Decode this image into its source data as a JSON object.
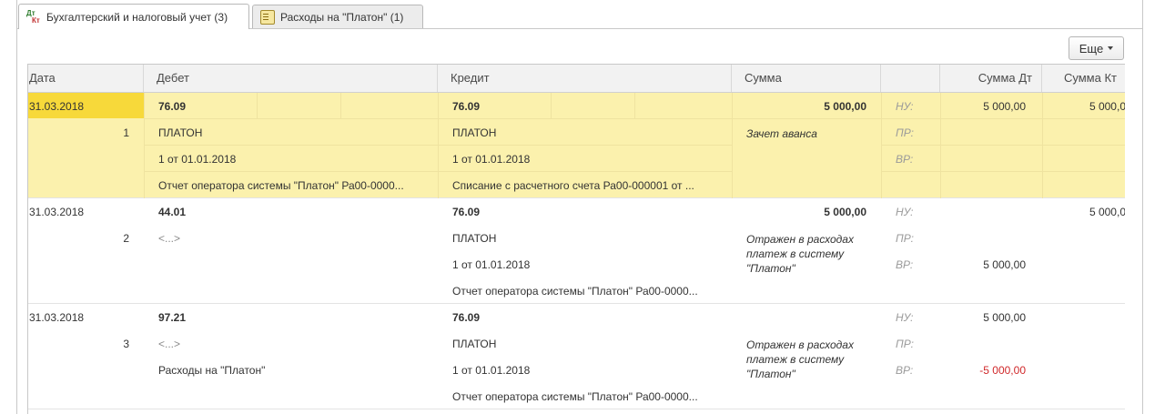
{
  "tabs": [
    {
      "label": "Бухгалтерский и налоговый учет (3)",
      "icon": "dt-kt-icon"
    },
    {
      "label": "Расходы на \"Платон\" (1)",
      "icon": "document-icon"
    }
  ],
  "more_button": {
    "label": "Еще"
  },
  "columns": [
    "Дата",
    "Дебет",
    "Кредит",
    "Сумма",
    "",
    "Сумма Дт",
    "Сумма Кт"
  ],
  "entries": [
    {
      "date": "31.03.2018",
      "num": "1",
      "debit": {
        "account": "76.09",
        "sub1": "ПЛАТОН",
        "sub2": "1 от 01.01.2018",
        "sub3": "Отчет оператора системы \"Платон\" Ра00-0000..."
      },
      "credit": {
        "account": "76.09",
        "sub1": "ПЛАТОН",
        "sub2": "1 от 01.01.2018",
        "sub3": "Списание с расчетного счета Ра00-000001 от ..."
      },
      "amount": "5 000,00",
      "content": "Зачет аванса",
      "codes": [
        "НУ:",
        "ПР:",
        "ВР:"
      ],
      "dt": {
        "nu": "5 000,00",
        "pr": "",
        "vr": ""
      },
      "kt": {
        "nu": "5 000,0",
        "pr": "",
        "vr": ""
      }
    },
    {
      "date": "31.03.2018",
      "num": "2",
      "debit": {
        "account": "44.01",
        "sub1": "<...>",
        "sub2": "",
        "sub3": ""
      },
      "credit": {
        "account": "76.09",
        "sub1": "ПЛАТОН",
        "sub2": "1 от 01.01.2018",
        "sub3": "Отчет оператора системы \"Платон\" Ра00-0000..."
      },
      "amount": "5 000,00",
      "content": "Отражен в расходах платеж в систему \"Платон\"",
      "codes": [
        "НУ:",
        "ПР:",
        "ВР:"
      ],
      "dt": {
        "nu": "",
        "pr": "",
        "vr": "5 000,00"
      },
      "kt": {
        "nu": "5 000,0",
        "pr": "",
        "vr": ""
      }
    },
    {
      "date": "31.03.2018",
      "num": "3",
      "debit": {
        "account": "97.21",
        "sub1": "<...>",
        "sub2": "Расходы на \"Платон\"",
        "sub3": ""
      },
      "credit": {
        "account": "76.09",
        "sub1": "ПЛАТОН",
        "sub2": "1 от 01.01.2018",
        "sub3": "Отчет оператора системы \"Платон\" Ра00-0000..."
      },
      "amount": "",
      "content": "Отражен в расходах платеж в систему \"Платон\"",
      "codes": [
        "НУ:",
        "ПР:",
        "ВР:"
      ],
      "dt": {
        "nu": "5 000,00",
        "pr": "",
        "vr": "-5 000,00"
      },
      "kt": {
        "nu": "",
        "pr": "",
        "vr": ""
      }
    }
  ]
}
